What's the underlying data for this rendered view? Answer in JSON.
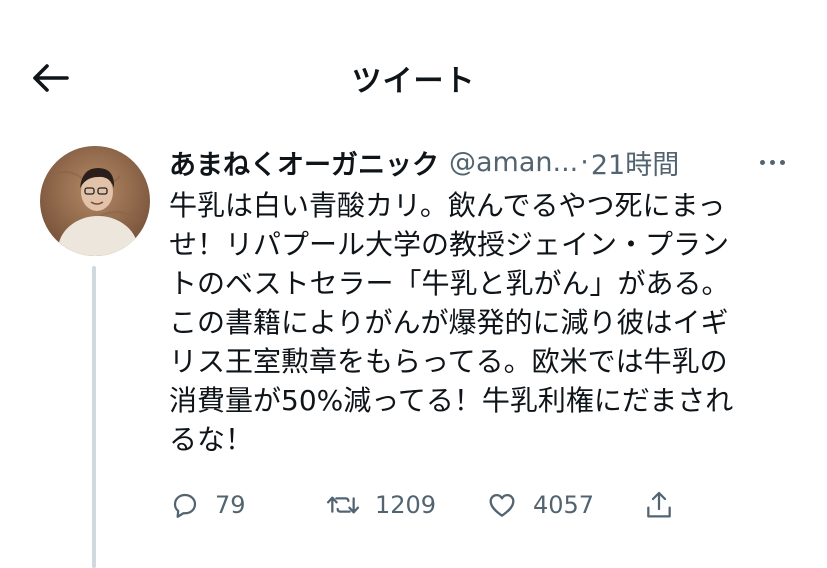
{
  "header": {
    "title": "ツイート"
  },
  "tweet": {
    "display_name": "あまねくオーガニック",
    "handle": "@aman...",
    "separator": "·",
    "time": "21時間",
    "text": "牛乳は白い青酸カリ。飲んでるやつ死にまっ\nせ！リパプール大学の教授ジェイン・プラン\nトのベストセラー「牛乳と乳がん」がある。\nこの書籍によりがんが爆発的に減り彼はイギ\nリス王室勲章をもらってる。欧米では牛乳の\n消費量が50%減ってる！牛乳利権にだまされ\nるな！"
  },
  "actions": {
    "replies": "79",
    "retweets": "1209",
    "likes": "4057"
  },
  "icons": {
    "back": "arrow-left-icon",
    "more": "more-horizontal-icon",
    "reply": "comment-bubble-icon",
    "retweet": "retweet-icon",
    "like": "heart-icon",
    "share": "share-icon"
  },
  "colors": {
    "text": "#0f1419",
    "secondary": "#536471",
    "thread_line": "#cfd9de"
  }
}
